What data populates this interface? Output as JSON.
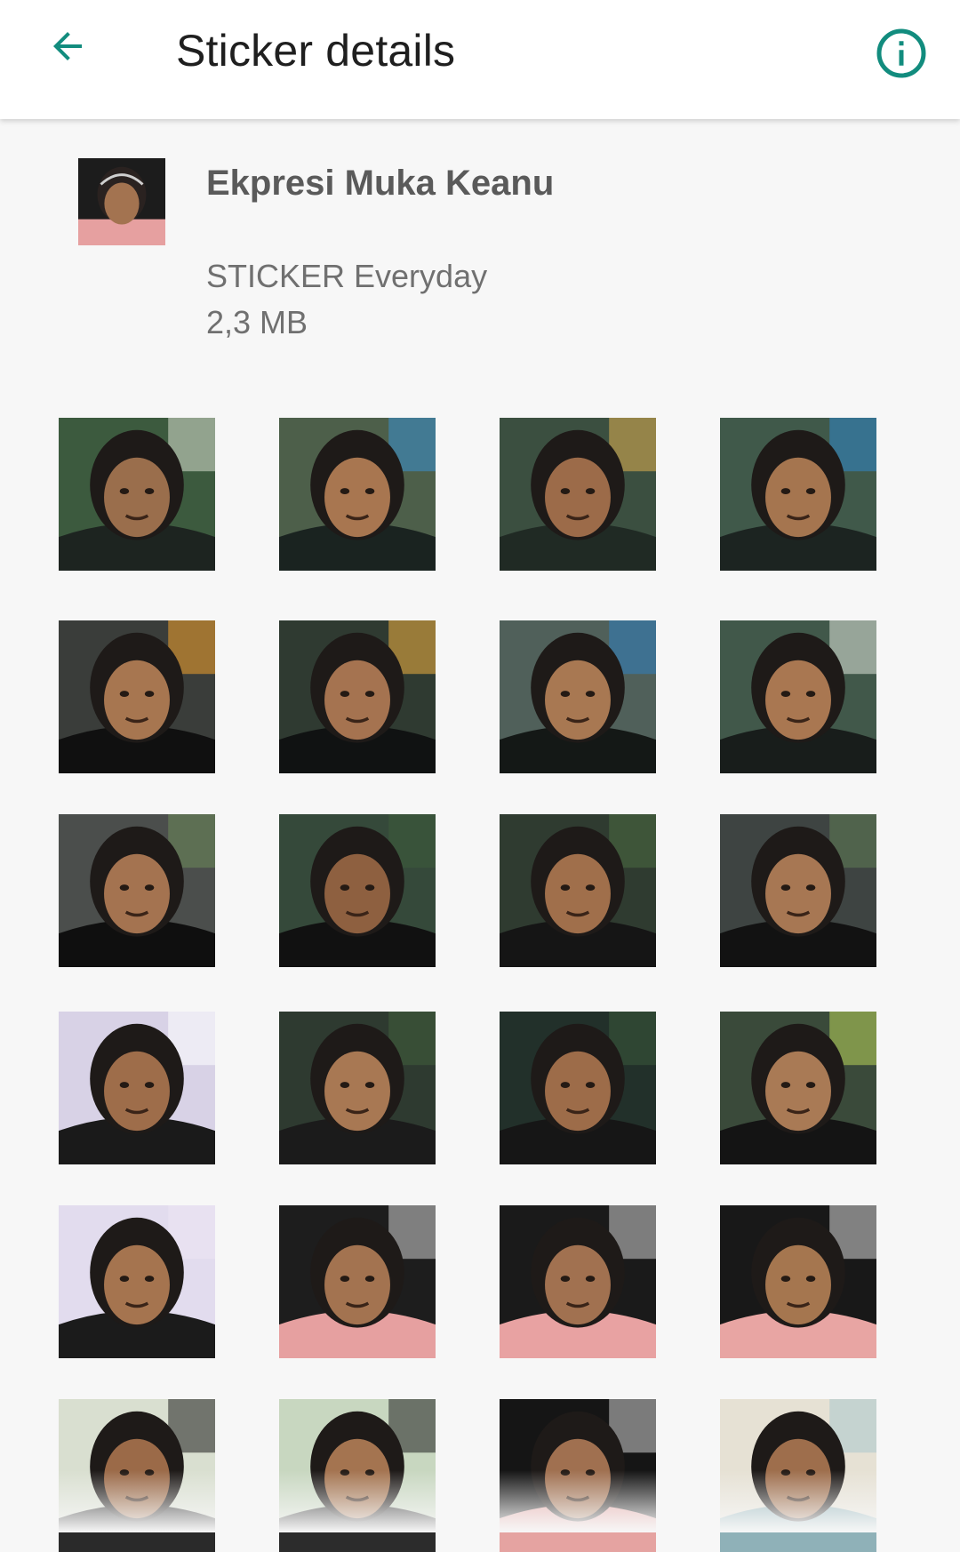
{
  "app_bar": {
    "title": "Sticker details",
    "back_icon": "arrow-left-icon",
    "info_icon": "info-icon",
    "accent_color": "#128c7e"
  },
  "pack": {
    "name": "Ekpresi Muka Keanu",
    "publisher": "STICKER Everyday",
    "size": "2,3 MB"
  },
  "stickers": [
    {
      "bg": "#3c5a3e",
      "shirt": "#1d2420",
      "skin": "#9a6e4c",
      "accent": "#d8e0d0"
    },
    {
      "bg": "#4d5f4a",
      "shirt": "#1a2320",
      "skin": "#a87650",
      "accent": "#3a8fcf"
    },
    {
      "bg": "#3b4f40",
      "shirt": "#202a24",
      "skin": "#9c6b49",
      "accent": "#e0b050"
    },
    {
      "bg": "#40594a",
      "shirt": "#1c2421",
      "skin": "#a5754f",
      "accent": "#2f86c8"
    },
    {
      "bg": "#3a3d3a",
      "shirt": "#101010",
      "skin": "#a77650",
      "accent": "#f2a22c"
    },
    {
      "bg": "#2f3a31",
      "shirt": "#101212",
      "skin": "#a57350",
      "accent": "#f0b040"
    },
    {
      "bg": "#50605a",
      "shirt": "#141816",
      "skin": "#a87852",
      "accent": "#2f7fc0"
    },
    {
      "bg": "#41584a",
      "shirt": "#181d1b",
      "skin": "#a97751",
      "accent": "#dfe6da"
    },
    {
      "bg": "#4b4e4c",
      "shirt": "#0f0f0f",
      "skin": "#a47350",
      "accent": "#6d8a5a"
    },
    {
      "bg": "#35493a",
      "shirt": "#111111",
      "skin": "#8e6040",
      "accent": "#3d5b3b"
    },
    {
      "bg": "#2f3b30",
      "shirt": "#151515",
      "skin": "#a06f4b",
      "accent": "#4a6b42"
    },
    {
      "bg": "#3e4442",
      "shirt": "#121212",
      "skin": "#a77753",
      "accent": "#5f7d56"
    },
    {
      "bg": "#d8d2e6",
      "shirt": "#1a1a1a",
      "skin": "#9e6d4a",
      "accent": "#ffffff"
    },
    {
      "bg": "#2e3a30",
      "shirt": "#1b1b1b",
      "skin": "#a87853",
      "accent": "#415e3c"
    },
    {
      "bg": "#22302a",
      "shirt": "#161616",
      "skin": "#9d6c49",
      "accent": "#3b5a3a"
    },
    {
      "bg": "#3a4a3a",
      "shirt": "#141414",
      "skin": "#a97a55",
      "accent": "#b8d45a"
    },
    {
      "bg": "#e2dcee",
      "shirt": "#1b1b1b",
      "skin": "#a5744f",
      "accent": "#ece6f4"
    },
    {
      "bg": "#1d1d1d",
      "shirt": "#e6a0a0",
      "skin": "#a37350",
      "accent": "#cfcfcf"
    },
    {
      "bg": "#1a1a1a",
      "shirt": "#e8a2a2",
      "skin": "#a17150",
      "accent": "#d0d0d0"
    },
    {
      "bg": "#181818",
      "shirt": "#e8a5a3",
      "skin": "#a5764f",
      "accent": "#d8d8d8"
    },
    {
      "bg": "#d9dfd0",
      "shirt": "#2a2a2a",
      "skin": "#9b6a48",
      "accent": "#1c1c1c"
    },
    {
      "bg": "#c8d7c0",
      "shirt": "#2c2c2c",
      "skin": "#a47450",
      "accent": "#1f1f1f"
    },
    {
      "bg": "#151515",
      "shirt": "#e5a3a1",
      "skin": "#a07050",
      "accent": "#d0d0d0"
    },
    {
      "bg": "#e6e1d4",
      "shirt": "#8fb1b8",
      "skin": "#9e6e4c",
      "accent": "#a9c8cc"
    }
  ]
}
